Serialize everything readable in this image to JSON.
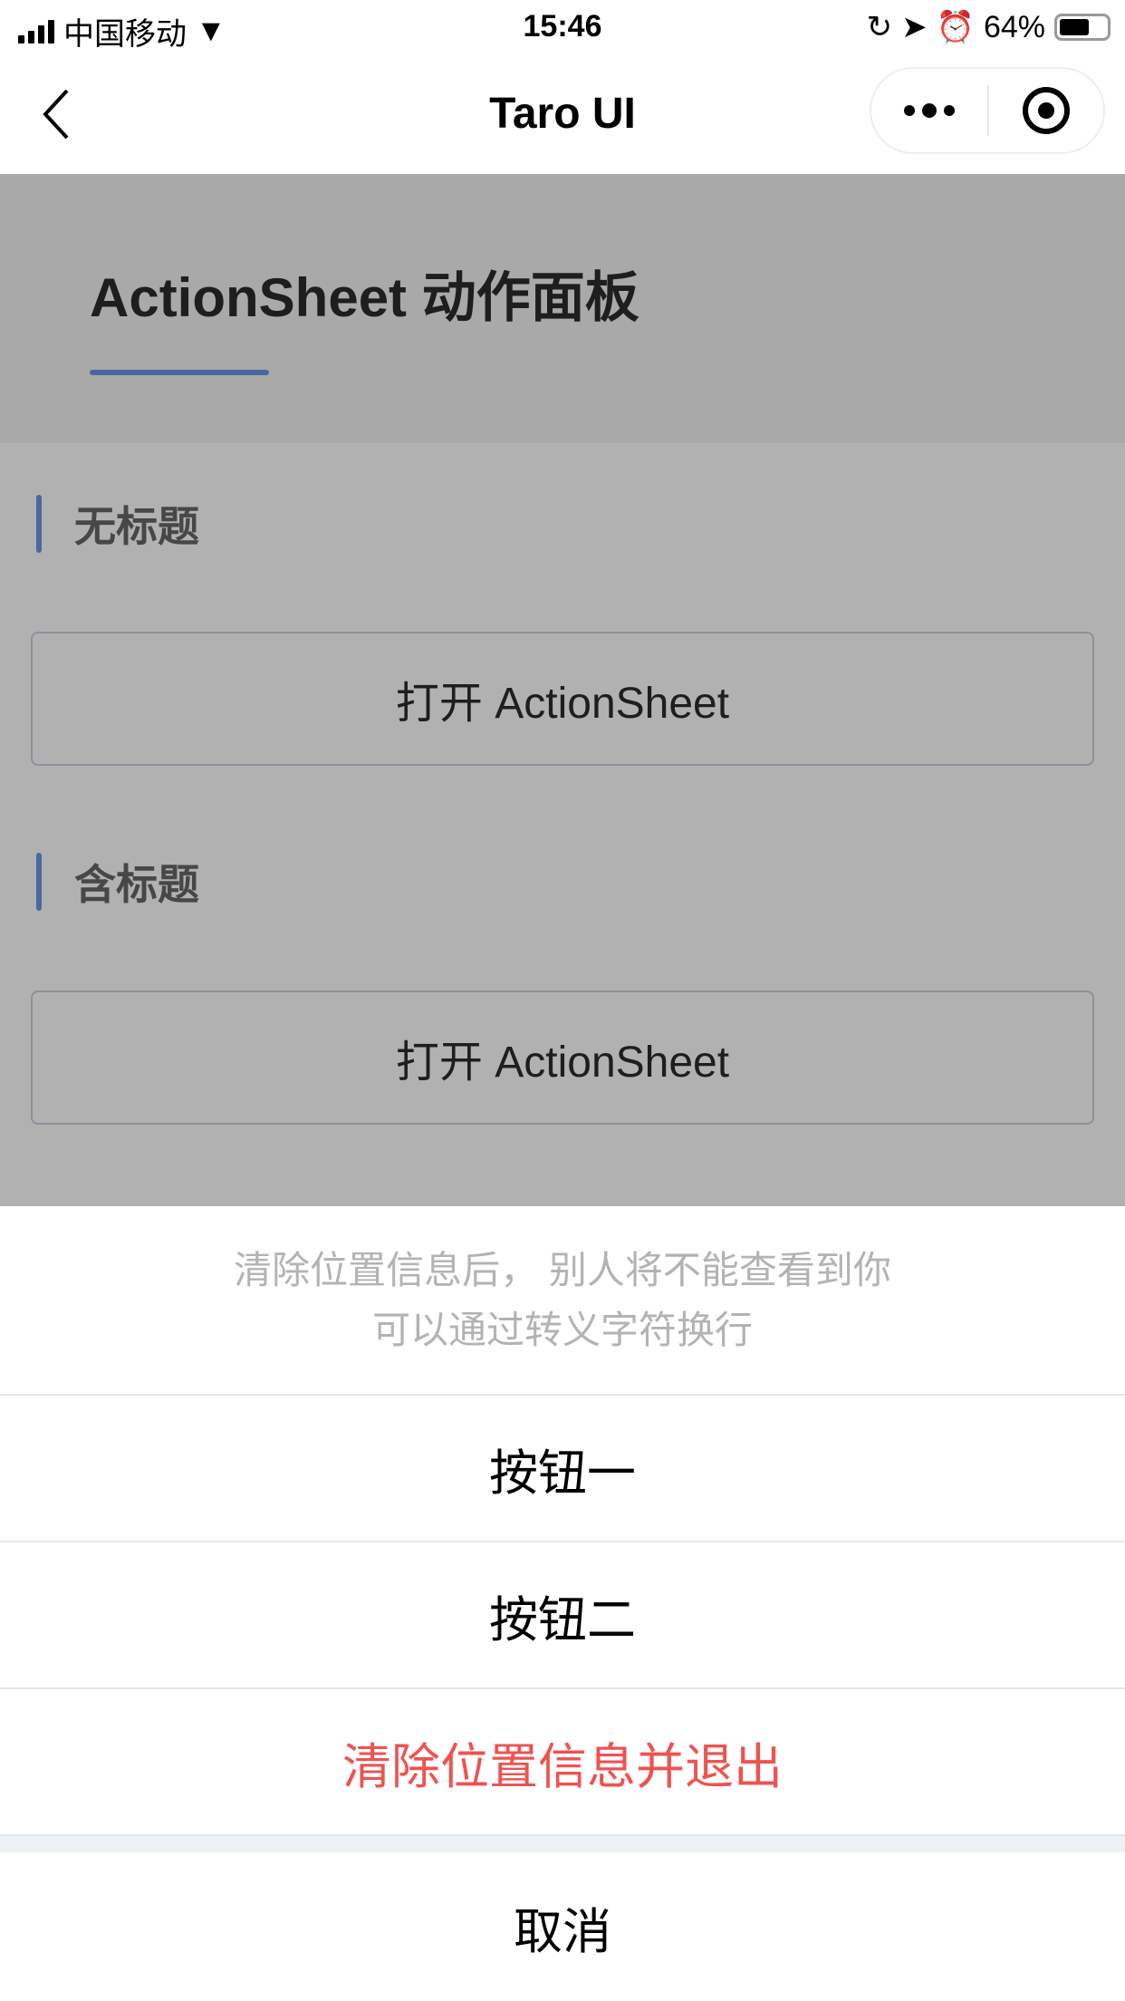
{
  "status_bar": {
    "carrier": "中国移动",
    "time": "15:46",
    "battery": "64%",
    "battery_level": 0.64
  },
  "nav": {
    "title": "Taro UI"
  },
  "page": {
    "title": "ActionSheet 动作面板",
    "sections": [
      {
        "title": "无标题",
        "button": "打开 ActionSheet"
      },
      {
        "title": "含标题",
        "button": "打开 ActionSheet"
      }
    ]
  },
  "action_sheet": {
    "title_lines": [
      "清除位置信息后， 别人将不能查看到你",
      "可以通过转义字符换行"
    ],
    "items": [
      "按钮一",
      "按钮二",
      "清除位置信息并退出"
    ],
    "cancel": "取消",
    "danger_color": "#ee5350"
  }
}
